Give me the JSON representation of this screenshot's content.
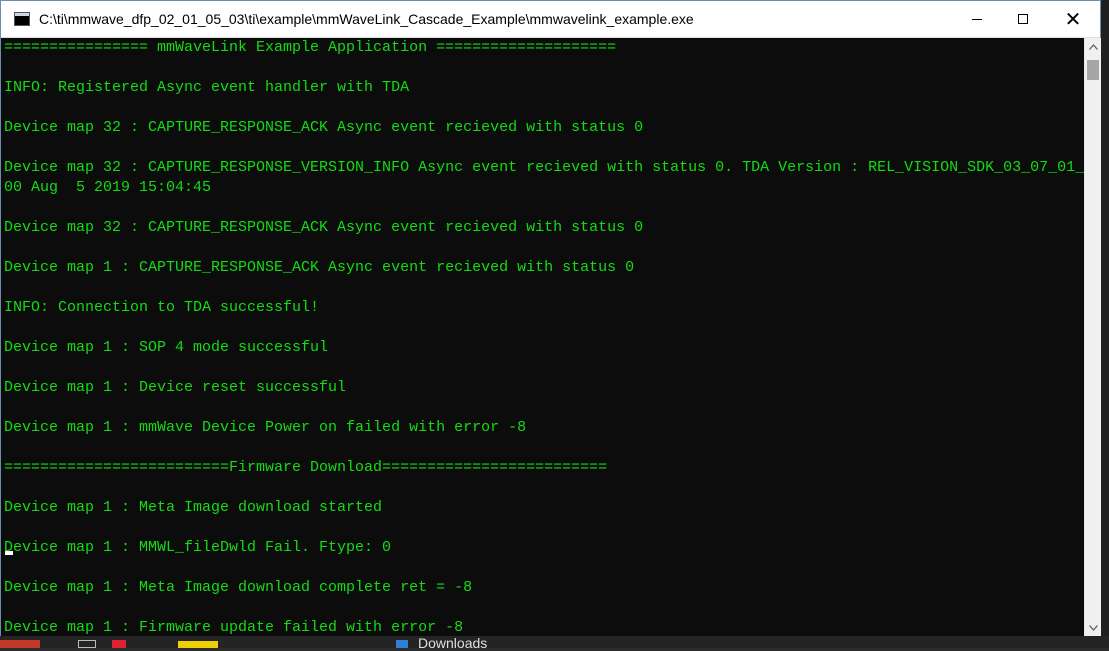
{
  "window": {
    "title": "C:\\ti\\mmwave_dfp_02_01_05_03\\ti\\example\\mmWaveLink_Cascade_Example\\mmwavelink_example.exe",
    "close_glyph": "✕"
  },
  "console": {
    "lines": [
      "================ mmWaveLink Example Application ====================",
      "",
      "INFO: Registered Async event handler with TDA",
      "",
      "Device map 32 : CAPTURE_RESPONSE_ACK Async event recieved with status 0",
      "",
      "Device map 32 : CAPTURE_RESPONSE_VERSION_INFO Async event recieved with status 0. TDA Version : REL_VISION_SDK_03_07_01_",
      "00 Aug  5 2019 15:04:45",
      "",
      "Device map 32 : CAPTURE_RESPONSE_ACK Async event recieved with status 0",
      "",
      "Device map 1 : CAPTURE_RESPONSE_ACK Async event recieved with status 0",
      "",
      "INFO: Connection to TDA successful!",
      "",
      "Device map 1 : SOP 4 mode successful",
      "",
      "Device map 1 : Device reset successful",
      "",
      "Device map 1 : mmWave Device Power on failed with error -8",
      "",
      "=========================Firmware Download=========================",
      "",
      "Device map 1 : Meta Image download started",
      "",
      "Device map 1 : MMWL_fileDwld Fail. Ftype: 0",
      "",
      "Device map 1 : Meta Image download complete ret = -8",
      "",
      "Device map 1 : Firmware update failed with error -8"
    ],
    "text_color": "#13dc13",
    "background": "#0c0c0c"
  },
  "scrollbar": {
    "up_icon": "up-arrow-icon",
    "down_icon": "down-arrow-icon"
  },
  "taskbar": {
    "downloads_label": "Downloads"
  }
}
